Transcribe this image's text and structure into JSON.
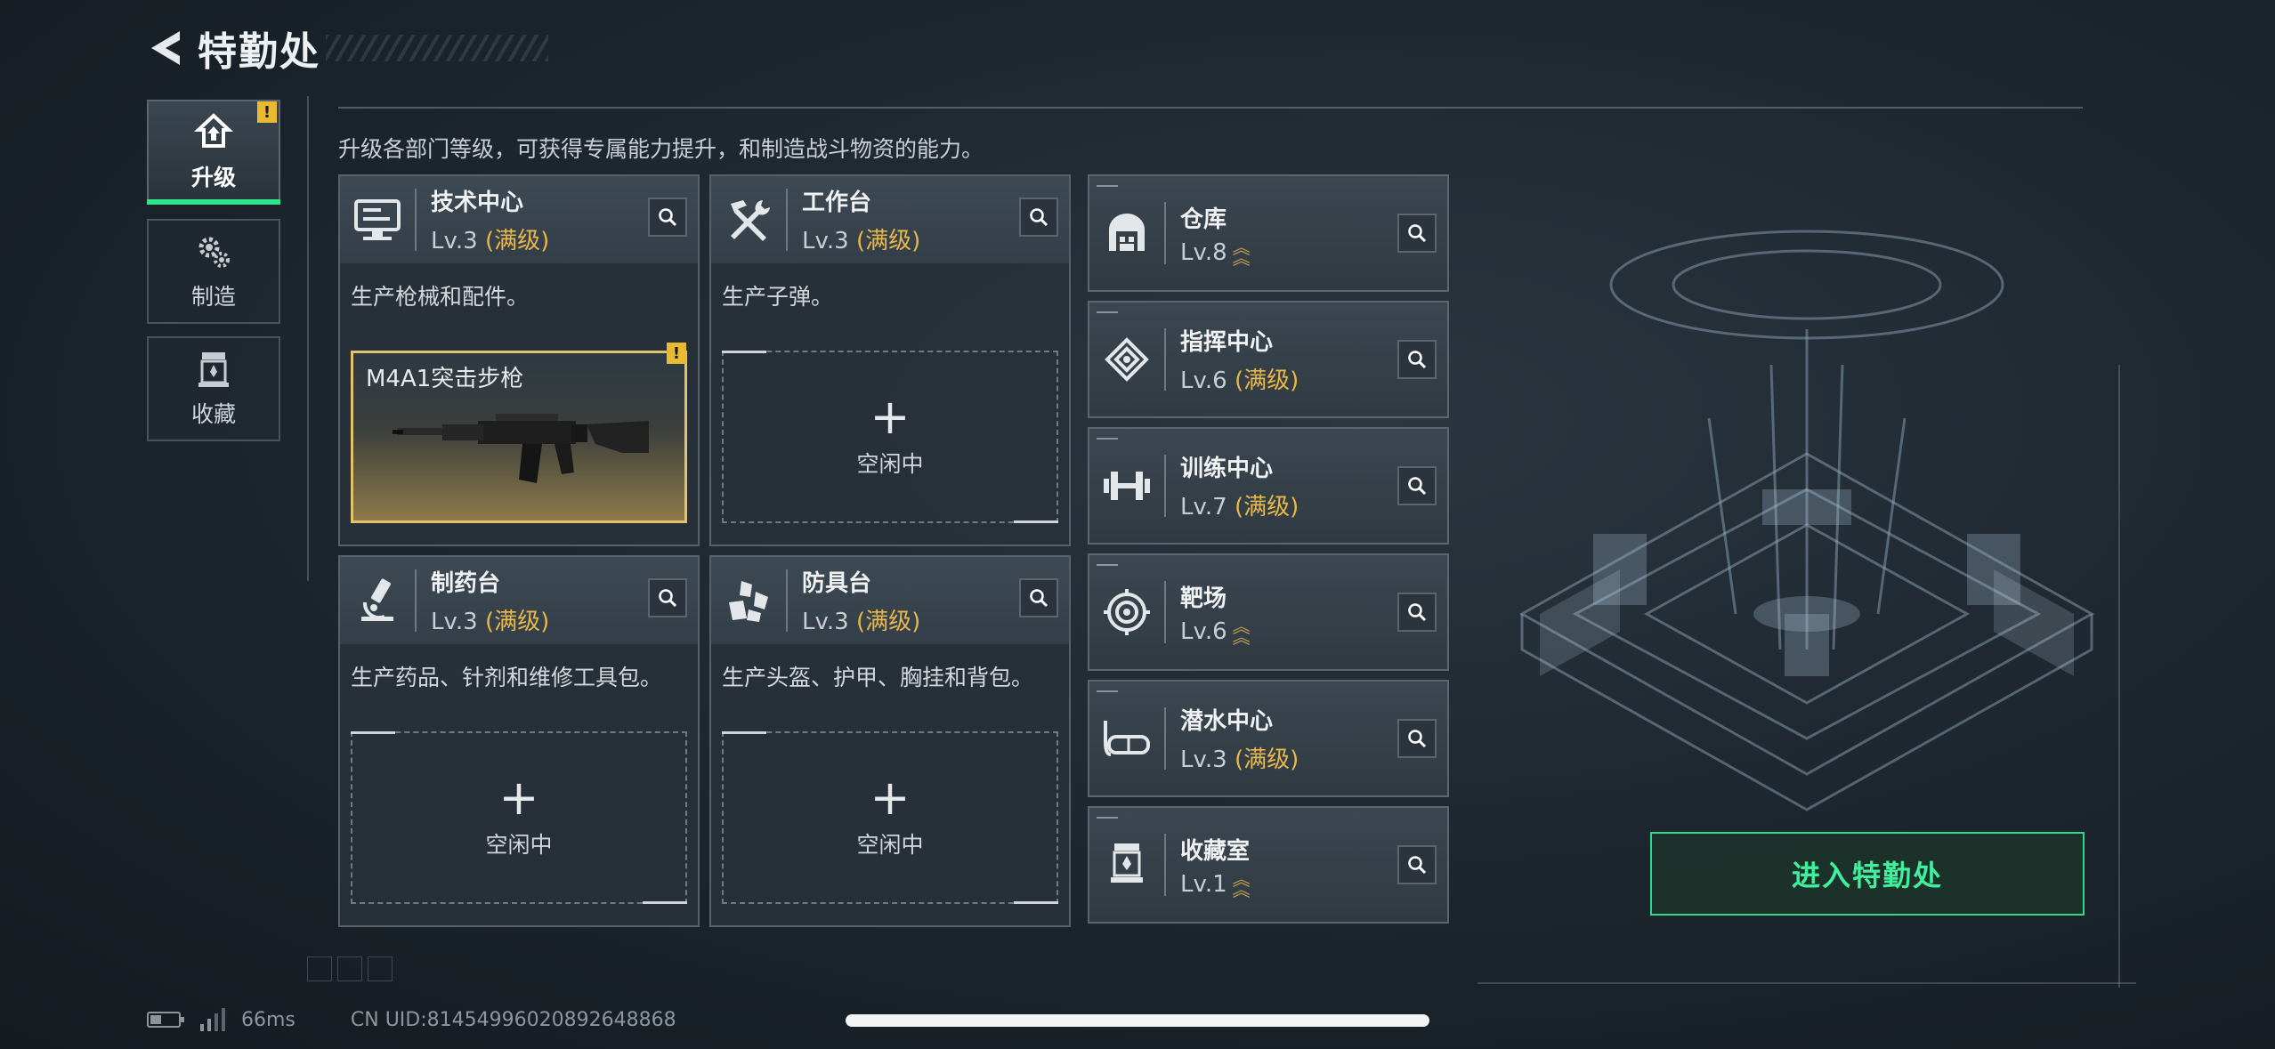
{
  "header": {
    "title": "特勤处"
  },
  "nav": {
    "tabs": [
      {
        "label": "升级",
        "icon": "upgrade-icon",
        "active": true,
        "badge": "!"
      },
      {
        "label": "制造",
        "icon": "gears-icon",
        "active": false
      },
      {
        "label": "收藏",
        "icon": "collection-icon",
        "active": false
      }
    ]
  },
  "description": "升级各部门等级，可获得专属能力提升，和制造战斗物资的能力。",
  "max_tag": "(满级)",
  "idle_text": "空闲中",
  "big_cards": [
    {
      "name": "技术中心",
      "level": "Lv.3",
      "max": true,
      "desc": "生产枪械和配件。",
      "icon": "monitor-icon",
      "slot": {
        "item": "M4A1突击步枪",
        "badge": "!"
      }
    },
    {
      "name": "工作台",
      "level": "Lv.3",
      "max": true,
      "desc": "生产子弹。",
      "icon": "tools-icon",
      "slot": null
    },
    {
      "name": "制药台",
      "level": "Lv.3",
      "max": true,
      "desc": "生产药品、针剂和维修工具包。",
      "icon": "microscope-icon",
      "slot": null
    },
    {
      "name": "防具台",
      "level": "Lv.3",
      "max": true,
      "desc": "生产头盔、护甲、胸挂和背包。",
      "icon": "armor-icon",
      "slot": null
    }
  ],
  "small_cards": [
    {
      "name": "仓库",
      "level": "Lv.8",
      "max": false,
      "icon": "warehouse-icon"
    },
    {
      "name": "指挥中心",
      "level": "Lv.6",
      "max": true,
      "icon": "command-icon"
    },
    {
      "name": "训练中心",
      "level": "Lv.7",
      "max": true,
      "icon": "dumbbell-icon"
    },
    {
      "name": "靶场",
      "level": "Lv.6",
      "max": false,
      "icon": "target-icon"
    },
    {
      "name": "潜水中心",
      "level": "Lv.3",
      "max": true,
      "icon": "diving-mask-icon"
    },
    {
      "name": "收藏室",
      "level": "Lv.1",
      "max": false,
      "icon": "trophy-case-icon"
    }
  ],
  "enter_button": "进入特勤处",
  "footer": {
    "ping": "66ms",
    "uid": "CN UID:81454996020892648868"
  },
  "colors": {
    "accent_green": "#2ee58a",
    "max_gold": "#e8b84a",
    "badge_yellow": "#e9b932"
  }
}
